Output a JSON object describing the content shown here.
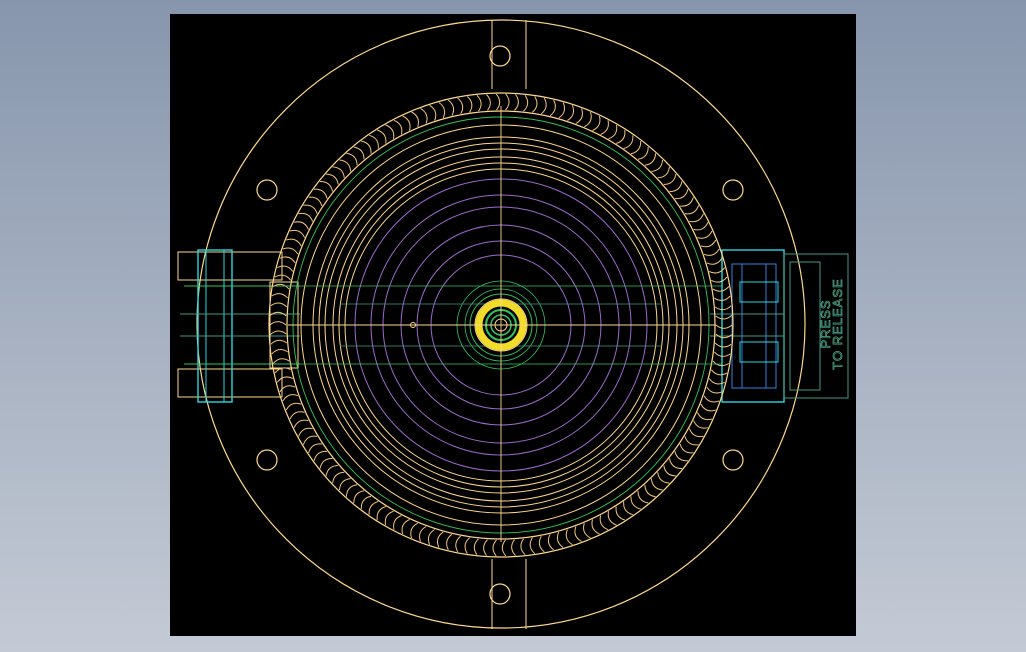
{
  "canvas": {
    "background": "#000000"
  },
  "colors": {
    "outline": "#ffd78a",
    "hatch": "#f4c27a",
    "violet": "#9a6acd",
    "green": "#2fc45f",
    "cyan": "#28d7e6",
    "blue": "#2f7fe0",
    "teal": "#3e9a86",
    "yellow": "#f2dc2a"
  },
  "label": {
    "line1": "PRESS",
    "line2": "TO RELEASE",
    "color": "#4fae8f"
  }
}
